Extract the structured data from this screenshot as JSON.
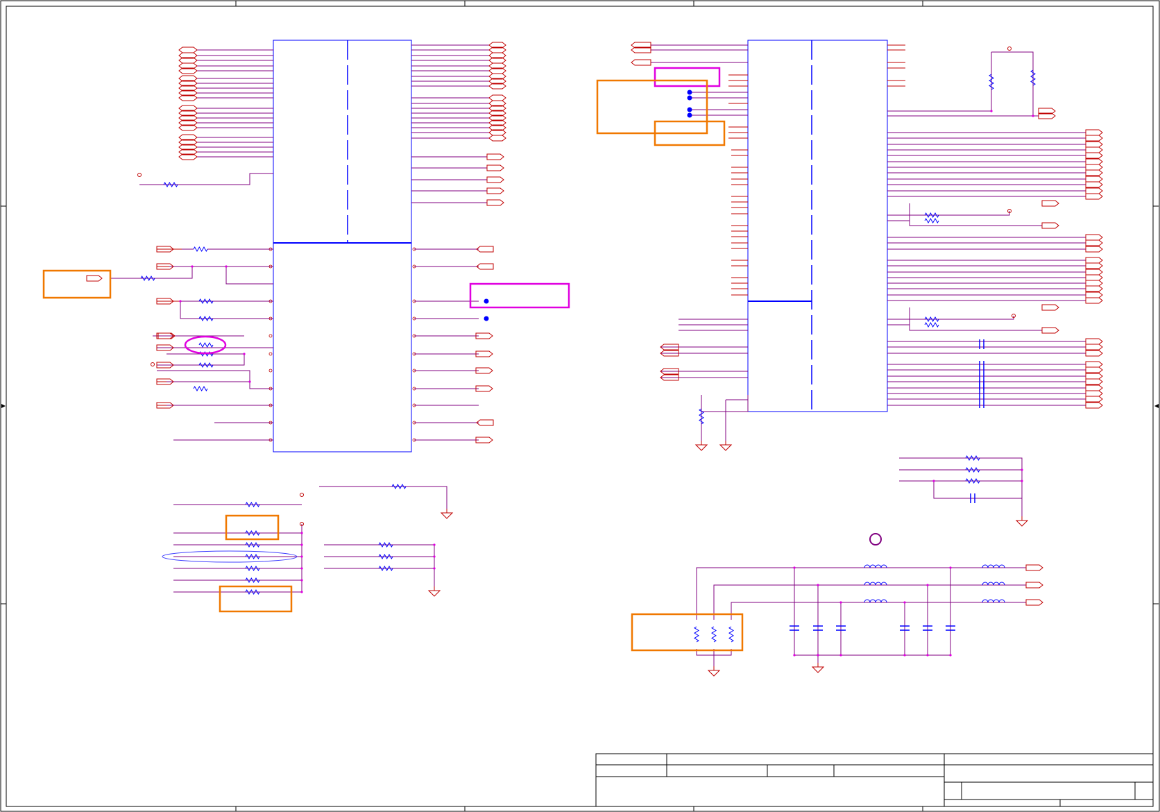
{
  "sheet": {
    "title_block": {
      "title": "",
      "size": "",
      "document_number": "",
      "revision": "",
      "date": "",
      "sheet": ""
    }
  },
  "colors": {
    "wire": "#c00000",
    "net": "#800080",
    "component": "#0000ff",
    "frame": "#000000",
    "highlight_orange": "#f07800",
    "highlight_magenta": "#e000e0",
    "junction": "#e000e0"
  }
}
